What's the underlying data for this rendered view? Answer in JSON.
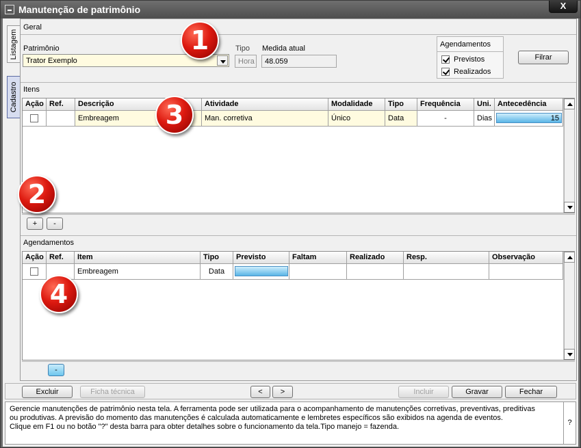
{
  "window": {
    "title": "Manutenção de patrimônio",
    "close_label": "X"
  },
  "side_tabs": {
    "listagem": "Listagem",
    "cadastro": "Cadastro"
  },
  "geral": {
    "section": "Geral",
    "patrimonio_label": "Patrimônio",
    "patrimonio_value": "Trator Exemplo",
    "tipo_label": "Tipo",
    "tipo_value": "Hora",
    "medida_label": "Medida atual",
    "medida_value": "48.059",
    "agendamentos_group": "Agendamentos",
    "previstos_label": "Previstos",
    "previstos_checked": true,
    "realizados_label": "Realizados",
    "realizados_checked": true,
    "filtrar_label": "Filrar"
  },
  "itens": {
    "section": "Itens",
    "columns": [
      "Ação",
      "Ref.",
      "Descrição",
      "Atividade",
      "Modalidade",
      "Tipo",
      "Frequência",
      "Uni.",
      "Antecedência"
    ],
    "rows": [
      {
        "ref": "",
        "descricao": "Embreagem",
        "atividade": "Man. corretiva",
        "modalidade": "Único",
        "tipo": "Data",
        "frequencia": "-",
        "uni": "Dias",
        "antecedencia": "15"
      }
    ],
    "add_label": "+",
    "remove_label": "-"
  },
  "agendamentos": {
    "section": "Agendamentos",
    "columns": [
      "Ação",
      "Ref.",
      "Item",
      "Tipo",
      "Previsto",
      "Faltam",
      "Realizado",
      "Resp.",
      "Observação"
    ],
    "rows": [
      {
        "ref": "",
        "item": "Embreagem",
        "tipo": "Data",
        "previsto": "",
        "faltam": "",
        "realizado": "",
        "resp": "",
        "observacao": ""
      }
    ],
    "remove_label": "-"
  },
  "toolbar": {
    "excluir": "Excluir",
    "ficha": "Ficha técnica",
    "prev": "<",
    "next": ">",
    "incluir": "Incluir",
    "gravar": "Gravar",
    "fechar": "Fechar"
  },
  "help": {
    "text": "Gerencie manutenções de patrimônio nesta tela. A ferramenta pode ser utilizada para o acompanhamento de manutenções corretivas, preventivas, preditivas ou produtivas. A previsão do momento das manutenções é calculada automaticamente e lembretes específicos são exibidos na agenda de eventos.",
    "text2": "Clique em F1 ou no botão \"?\" desta barra para obter detalhes sobre o funcionamento da tela.Tipo manejo = fazenda.",
    "question": "?"
  },
  "badges": [
    "1",
    "2",
    "3",
    "4"
  ],
  "colors": {
    "title_bar": "#4d4d4d",
    "yellow_field": "#fffbe0",
    "badge_red": "#dd1a10",
    "progress_blue": "#5ab5e6"
  }
}
